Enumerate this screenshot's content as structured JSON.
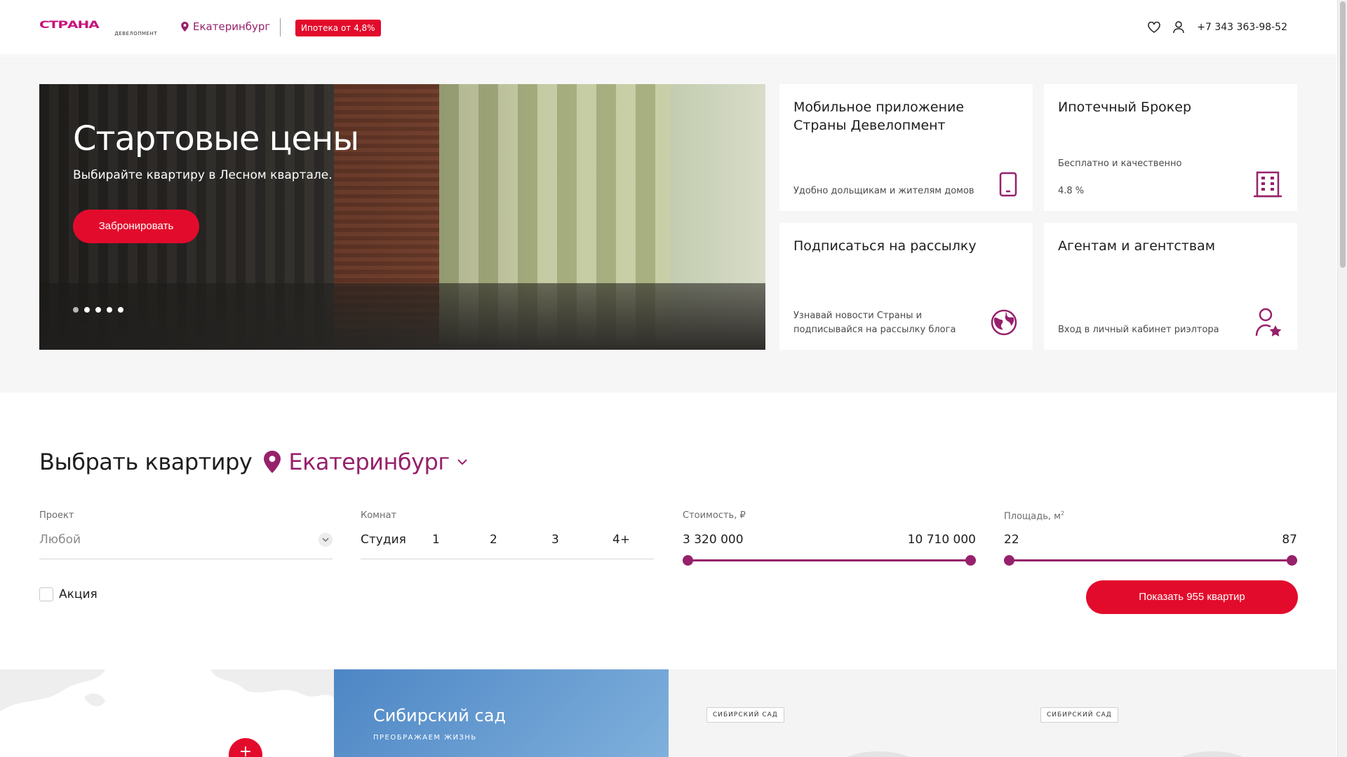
{
  "header": {
    "logo_word": "СТРАНА",
    "logo_sub": "ДЕВЕЛОПМЕНТ",
    "city": "Екатеринбург",
    "mortgage_badge": "Ипотека от 4,8%",
    "phone": "+7 343 363-98-52"
  },
  "hero": {
    "title": "Стартовые цены",
    "subtitle": "Выбирайте квартиру в Лесном квартале.",
    "button": "Забронировать",
    "slides_count": 5,
    "active_slide": 1
  },
  "cards": [
    {
      "title": "Мобильное приложение Страны Девелопмент",
      "desc": "Удобно дольщикам и жителям домов",
      "icon": "phone-icon"
    },
    {
      "title": "Ипотечный Брокер",
      "desc": "Бесплатно и качественно",
      "extra": "4.8 %",
      "icon": "building-icon"
    },
    {
      "title": "Подписаться на рассылку",
      "desc": "Узнавай новости Страны и подписывайся на рассылку блога",
      "icon": "globe-icon"
    },
    {
      "title": "Агентам и агентствам",
      "desc": "Вход в личный кабинет риэлтора",
      "icon": "user-star-icon"
    }
  ],
  "filter": {
    "title": "Выбрать квартиру",
    "city": "Екатеринбург",
    "project_label": "Проект",
    "project_value": "Любой",
    "rooms_label": "Комнат",
    "rooms": [
      "Студия",
      "1",
      "2",
      "3",
      "4+"
    ],
    "price_label": "Стоимость, ₽",
    "price_min": "3 320 000",
    "price_max": "10 710 000",
    "area_label": "Площадь, м",
    "area_sup": "2",
    "area_min": "22",
    "area_max": "87",
    "promo_label": "Акция",
    "show_button": "Показать 955 квартир"
  },
  "bottom": {
    "map_plus": "+",
    "project_title": "Сибирский сад",
    "project_slogan": "ПРЕОБРАЖАЕМ ЖИЗНЬ",
    "tag1": "СИБИРСКИЙ САД",
    "tag2": "СИБИРСКИЙ САД"
  },
  "colors": {
    "accent_red": "#e30b2c",
    "brand_purple": "#96216b",
    "logo_pink": "#c8127d"
  }
}
